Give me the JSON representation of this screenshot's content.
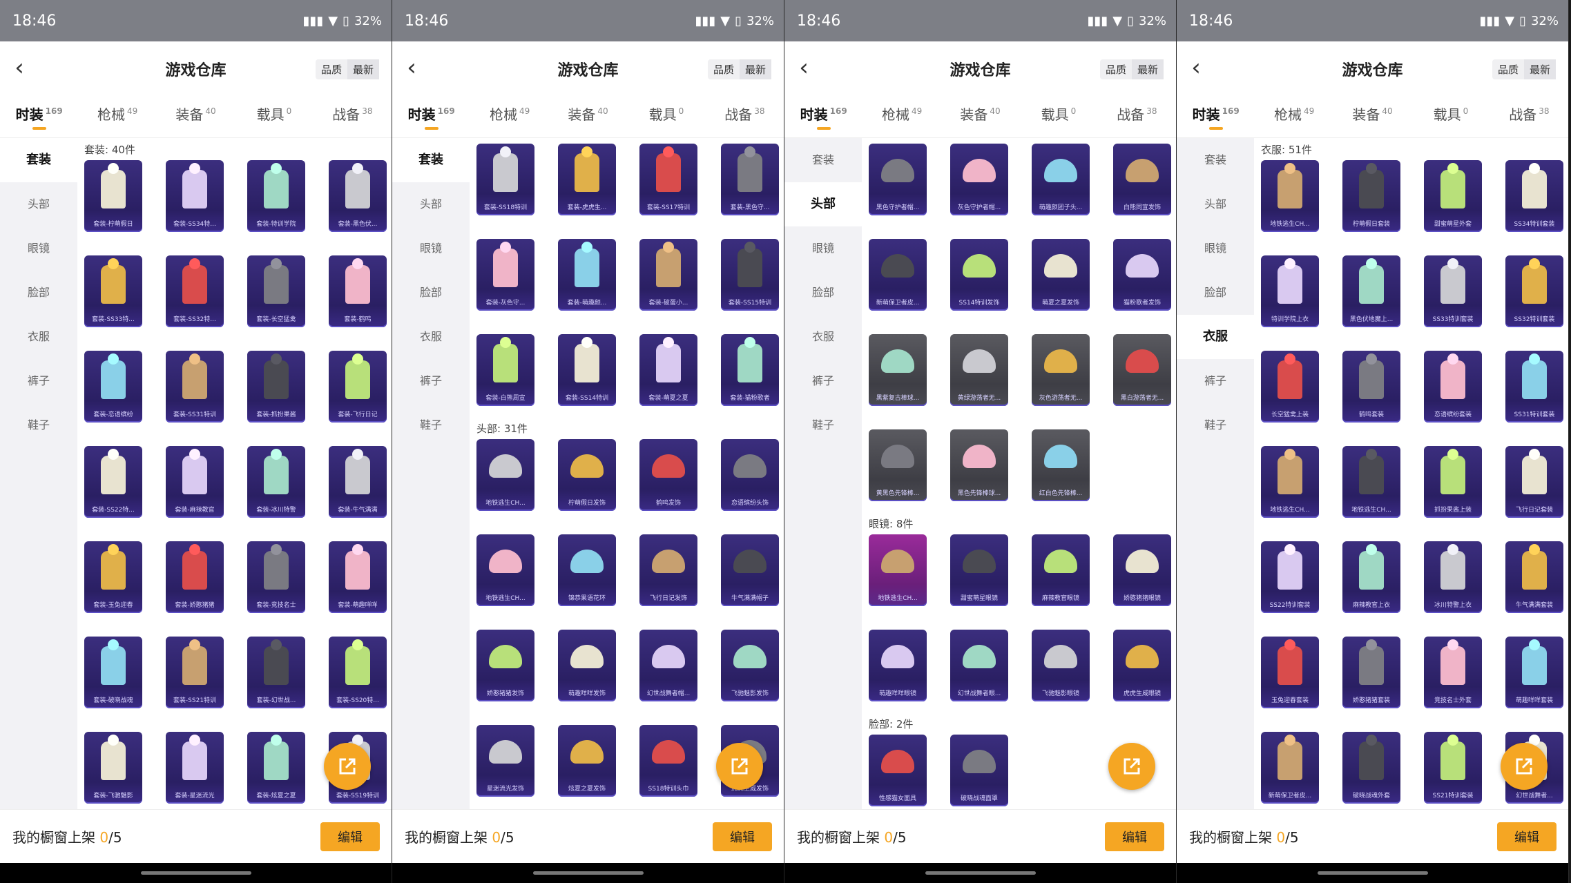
{
  "status": {
    "time": "18:46",
    "battery": "32%"
  },
  "header": {
    "title": "游戏仓库",
    "sort_quality": "品质",
    "sort_newest": "最新"
  },
  "categories": [
    {
      "label": "时装",
      "count": "169"
    },
    {
      "label": "枪械",
      "count": "49"
    },
    {
      "label": "装备",
      "count": "40"
    },
    {
      "label": "载具",
      "count": "0"
    },
    {
      "label": "战备",
      "count": "38"
    }
  ],
  "sidebar": [
    "套装",
    "头部",
    "眼镜",
    "脸部",
    "衣服",
    "裤子",
    "鞋子"
  ],
  "bottom": {
    "label": "我的橱窗上架 ",
    "count": "0",
    "total": "/5",
    "edit": "编辑"
  },
  "colors": {
    "accent": "#f5a623",
    "card": "#2f2470"
  },
  "panels": [
    {
      "active_side": 0,
      "sections": [
        {
          "title": "套装: 40件",
          "items": [
            "套装-柠萌假日",
            "套装-SS34特...",
            "套装-特训学院",
            "套装-黑色伏...",
            "套装-SS33特...",
            "套装-SS32特...",
            "套装-长空猛禽",
            "套装-鹤鸣",
            "套装-恋语缤纷",
            "套装-SS31特训",
            "套装-抓扮果酱",
            "套装-飞行日记",
            "套装-SS22特...",
            "套装-麻辣教官",
            "套装-冰川特警",
            "套装-牛气满满",
            "套装-玉兔迎春",
            "套装-娇憨猪猪",
            "套装-竞技名士",
            "套装-萌趣咩咩",
            "套装-破晓战魂",
            "套装-SS21特训",
            "套装-幻世战...",
            "套装-SS20特...",
            "套装-飞驰魅影",
            "套装-星迷流光",
            "套装-炫夏之夏",
            "套装-SS19特训"
          ]
        }
      ]
    },
    {
      "active_side": 0,
      "sections": [
        {
          "title": "",
          "items": [
            "套装-SS18特训",
            "套装-虎虎生...",
            "套装-SS17特训",
            "套装-黑色守...",
            "套装-灰色守...",
            "套装-萌趣颜...",
            "套装-破蛋小...",
            "套装-SS15特训",
            "套装-白熊周宣",
            "套装-SS14特训",
            "套装-萌夏之夏",
            "套装-猫粉歌者"
          ]
        },
        {
          "title": "头部: 31件",
          "items": [
            "地铁逃生CH...",
            "柠萌假日发饰",
            "鹤鸣发饰",
            "恋语缤纷头饰",
            "地铁逃生CH...",
            "锦恭果语花环",
            "飞行日记发饰",
            "牛气满满帽子",
            "娇憨猪猪发饰",
            "萌趣咩咩发饰",
            "幻世战舞者帽...",
            "飞驰魅影发饰",
            "星迷流光发饰",
            "炫夏之夏发饰",
            "SS18特训头巾",
            "虎虎生威发饰"
          ]
        }
      ]
    },
    {
      "active_side": 1,
      "sections": [
        {
          "title": "",
          "items": [
            "黑色守护者帽...",
            "灰色守护者帽...",
            "萌趣颜团子头...",
            "白熊同宣发饰",
            "新萌保卫者皮...",
            "SS14特训发饰",
            "萌夏之夏发饰",
            "猫粉歌者发饰",
            "黑紫复古棒球...",
            "黄绿游荡者无...",
            "灰色游荡者无...",
            "黑白游荡者无...",
            "黄黑色先锋棒...",
            "黑色先锋棒球...",
            "红白色先锋棒..."
          ]
        },
        {
          "title": "眼镜: 8件",
          "items": [
            "地铁逃生CH...",
            "甜蜜萌星眼镜",
            "麻辣教官眼镜",
            "娇憨猪猪眼镜",
            "萌趣咩咩眼镜",
            "幻世战舞者眼...",
            "飞驰魅影眼镜",
            "虎虎生威眼镜"
          ]
        },
        {
          "title": "脸部: 2件",
          "items": [
            "性感猫女面具",
            "破晓战魂面罩"
          ]
        },
        {
          "title": "衣服: 51件",
          "items": []
        }
      ]
    },
    {
      "active_side": 4,
      "sections": [
        {
          "title": "衣服: 51件",
          "items": [
            "地铁逃生CH...",
            "柠萌假日套装",
            "甜蜜萌星外套",
            "SS34特训套装",
            "特训学院上衣",
            "黑色伏地魔上...",
            "SS33特训套装",
            "SS32特训套装",
            "长空猛禽上装",
            "鹤鸣套装",
            "恋语缤纷套装",
            "SS31特训套装",
            "地铁逃生CH...",
            "地铁逃生CH...",
            "抓扮果酱上装",
            "飞行日记套装",
            "SS22特训套装",
            "麻辣教官上衣",
            "冰川特警上衣",
            "牛气满满套装",
            "玉兔迎春套装",
            "娇憨猪猪套装",
            "竞技名士外套",
            "萌趣咩咩套装",
            "新萌保卫者皮...",
            "破晓战魂外套",
            "SS21特训套装",
            "幻世战舞者..."
          ]
        }
      ]
    }
  ]
}
